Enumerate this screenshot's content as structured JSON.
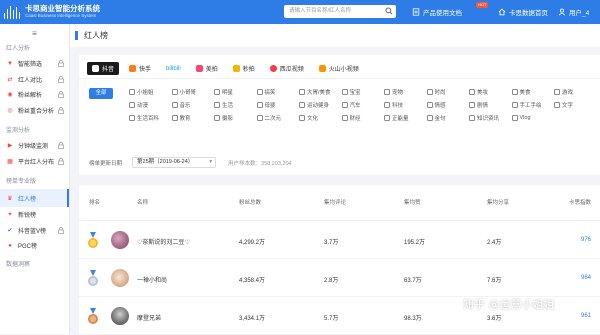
{
  "topbar": {
    "logo_title": "卡思商业智能分析系统",
    "logo_subtitle": "Caasi Business Intelligence System",
    "search_placeholder": "请输入节目名称/红人名称",
    "nav": [
      {
        "label": "产品使用文档",
        "icon": "doc-icon",
        "badge": "HOT"
      },
      {
        "label": "卡思数据首页",
        "icon": "home-icon"
      },
      {
        "label": "用户_4",
        "icon": "user-icon"
      }
    ]
  },
  "sidebar": {
    "sections": [
      {
        "title": "红人分析",
        "items": [
          {
            "label": "智能筛选",
            "locked": true
          },
          {
            "label": "红人对比",
            "locked": true
          },
          {
            "label": "粉丝解析",
            "locked": true
          },
          {
            "label": "粉丝重合分析",
            "locked": true
          }
        ]
      },
      {
        "title": "监测分析",
        "items": [
          {
            "label": "分钟级监测",
            "locked": true
          },
          {
            "label": "平台红人分布",
            "locked": true
          }
        ]
      },
      {
        "title": "榜单专业版",
        "items": [
          {
            "label": "红人榜",
            "active": true
          },
          {
            "label": "新锐榜"
          },
          {
            "label": "抖音蓝V榜",
            "locked": true
          },
          {
            "label": "PGC榜"
          }
        ]
      },
      {
        "title": "数据洞察",
        "items": []
      }
    ]
  },
  "main": {
    "title": "红人榜",
    "platforms": [
      "抖音",
      "快手",
      "bilibili",
      "美拍",
      "秒拍",
      "西瓜视频",
      "火山小视频"
    ],
    "all_label": "全部",
    "categories": [
      "小姐姐",
      "小哥哥",
      "明星",
      "搞笑",
      "大胃/美食",
      "宝宝",
      "宠物",
      "时尚",
      "美妆",
      "美食",
      "游戏",
      "动漫",
      "音乐",
      "生活",
      "母婴",
      "运动健身",
      "汽车",
      "科技",
      "情感",
      "剧情",
      "手工手绘",
      "文字",
      "生活百科",
      "教育",
      "摄影",
      "二次元",
      "文化",
      "财经",
      "正能量",
      "金句",
      "知识资讯",
      "Vlog"
    ],
    "date_label": "榜单更新日期",
    "date_value": "第25期（2019-06-24）",
    "sample_label": "用户样本数：358,203,204"
  },
  "table": {
    "headers": [
      "排名",
      "名称",
      "粉丝总数",
      "集均评论",
      "集均赞",
      "集均分享",
      "卡思指数"
    ],
    "rows": [
      {
        "name": "♡奈斯说的刘二豆♡",
        "fans": "4,299.2万",
        "comments": "3.7万",
        "likes": "195.2万",
        "shares": "2.4万",
        "index": "976"
      },
      {
        "name": "一禅小和尚",
        "fans": "4,358.4万",
        "comments": "2.8万",
        "likes": "63.7万",
        "shares": "7.6万",
        "index": "964"
      },
      {
        "name": "摩登兄弟",
        "fans": "3,434.1万",
        "comments": "5.7万",
        "likes": "98.3万",
        "shares": "3.6万",
        "index": "961"
      }
    ]
  },
  "watermark": "知乎 @运营小姐姐",
  "colors": {
    "brand": "#2e7ce6",
    "lock": "#f0473c"
  }
}
